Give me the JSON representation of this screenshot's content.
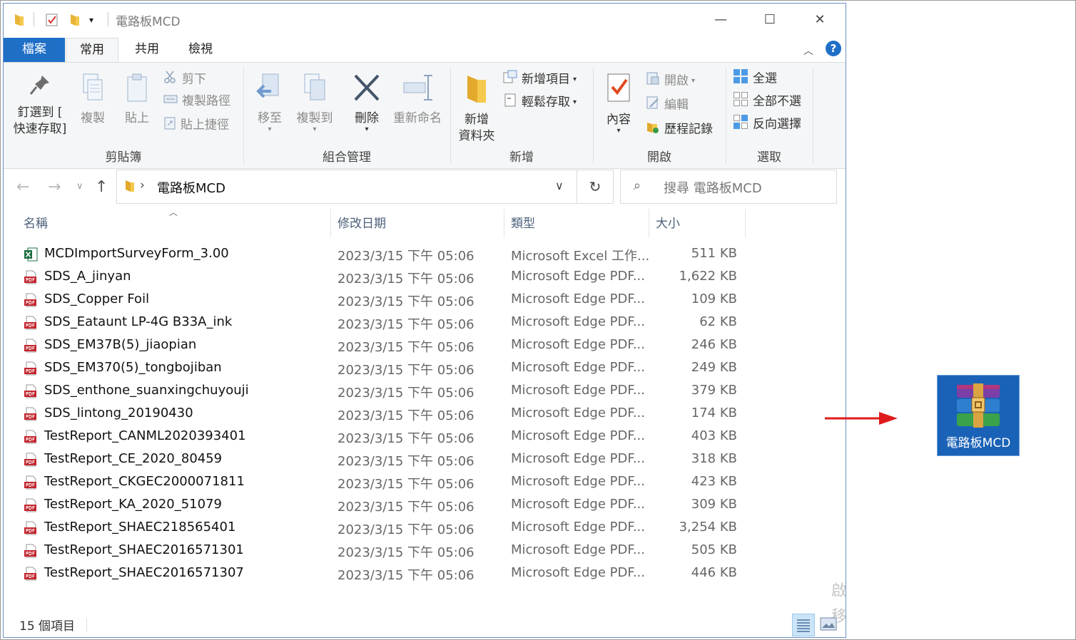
{
  "window": {
    "title": "電路板MCD",
    "controls": {
      "minimize": "—",
      "maximize": "☐",
      "close": "✕"
    }
  },
  "tabs": {
    "file": "檔案",
    "home": "常用",
    "share": "共用",
    "view": "檢視"
  },
  "ribbon": {
    "clipboard": {
      "label": "剪貼簿",
      "pin_line1": "釘選到 [",
      "pin_line2": "快速存取]",
      "copy": "複製",
      "paste": "貼上",
      "cut": "剪下",
      "copy_path": "複製路徑",
      "paste_shortcut": "貼上捷徑"
    },
    "organize": {
      "label": "組合管理",
      "move_to": "移至",
      "copy_to": "複製到",
      "delete": "刪除",
      "rename": "重新命名"
    },
    "new": {
      "label": "新增",
      "new_folder_line1": "新增",
      "new_folder_line2": "資料夾",
      "new_item": "新增項目",
      "easy_access": "輕鬆存取"
    },
    "open": {
      "label": "開啟",
      "properties": "內容",
      "open": "開啟",
      "edit": "編輯",
      "history": "歷程記錄"
    },
    "select": {
      "label": "選取",
      "select_all": "全選",
      "select_none": "全部不選",
      "invert": "反向選擇"
    }
  },
  "address": {
    "path": "電路板MCD",
    "search_placeholder": "搜尋 電路板MCD"
  },
  "columns": {
    "name": "名稱",
    "date": "修改日期",
    "type": "類型",
    "size": "大小"
  },
  "files": [
    {
      "name": "MCDImportSurveyForm_3.00",
      "date": "2023/3/15 下午 05:06",
      "type": "Microsoft Excel 工作...",
      "size": "511 KB",
      "icon": "excel-icon"
    },
    {
      "name": "SDS_A_jinyan",
      "date": "2023/3/15 下午 05:06",
      "type": "Microsoft Edge PDF...",
      "size": "1,622 KB",
      "icon": "pdf-icon"
    },
    {
      "name": "SDS_Copper Foil",
      "date": "2023/3/15 下午 05:06",
      "type": "Microsoft Edge PDF...",
      "size": "109 KB",
      "icon": "pdf-icon"
    },
    {
      "name": "SDS_Eataunt LP-4G B33A_ink",
      "date": "2023/3/15 下午 05:06",
      "type": "Microsoft Edge PDF...",
      "size": "62 KB",
      "icon": "pdf-icon"
    },
    {
      "name": "SDS_EM37B(5)_jiaopian",
      "date": "2023/3/15 下午 05:06",
      "type": "Microsoft Edge PDF...",
      "size": "246 KB",
      "icon": "pdf-icon"
    },
    {
      "name": "SDS_EM370(5)_tongbojiban",
      "date": "2023/3/15 下午 05:06",
      "type": "Microsoft Edge PDF...",
      "size": "249 KB",
      "icon": "pdf-icon"
    },
    {
      "name": "SDS_enthone_suanxingchuyouji",
      "date": "2023/3/15 下午 05:06",
      "type": "Microsoft Edge PDF...",
      "size": "379 KB",
      "icon": "pdf-icon"
    },
    {
      "name": "SDS_lintong_20190430",
      "date": "2023/3/15 下午 05:06",
      "type": "Microsoft Edge PDF...",
      "size": "174 KB",
      "icon": "pdf-icon"
    },
    {
      "name": "TestReport_CANML2020393401",
      "date": "2023/3/15 下午 05:06",
      "type": "Microsoft Edge PDF...",
      "size": "403 KB",
      "icon": "pdf-icon"
    },
    {
      "name": "TestReport_CE_2020_80459",
      "date": "2023/3/15 下午 05:06",
      "type": "Microsoft Edge PDF...",
      "size": "318 KB",
      "icon": "pdf-icon"
    },
    {
      "name": "TestReport_CKGEC2000071811",
      "date": "2023/3/15 下午 05:06",
      "type": "Microsoft Edge PDF...",
      "size": "423 KB",
      "icon": "pdf-icon"
    },
    {
      "name": "TestReport_KA_2020_51079",
      "date": "2023/3/15 下午 05:06",
      "type": "Microsoft Edge PDF...",
      "size": "309 KB",
      "icon": "pdf-icon"
    },
    {
      "name": "TestReport_SHAEC218565401",
      "date": "2023/3/15 下午 05:06",
      "type": "Microsoft Edge PDF...",
      "size": "3,254 KB",
      "icon": "pdf-icon"
    },
    {
      "name": "TestReport_SHAEC2016571301",
      "date": "2023/3/15 下午 05:06",
      "type": "Microsoft Edge PDF...",
      "size": "505 KB",
      "icon": "pdf-icon"
    },
    {
      "name": "TestReport_SHAEC2016571307",
      "date": "2023/3/15 下午 05:06",
      "type": "Microsoft Edge PDF...",
      "size": "446 KB",
      "icon": "pdf-icon"
    }
  ],
  "status": {
    "count": "15 個項目",
    "watermark_1": "啟",
    "watermark_2": "移"
  },
  "desktop": {
    "archive_label": "電路板MCD"
  },
  "colors": {
    "accent": "#1f6fc7",
    "pdf_red": "#c4262e",
    "excel_green": "#1d6f42",
    "arrow_red": "#e01b1b"
  }
}
